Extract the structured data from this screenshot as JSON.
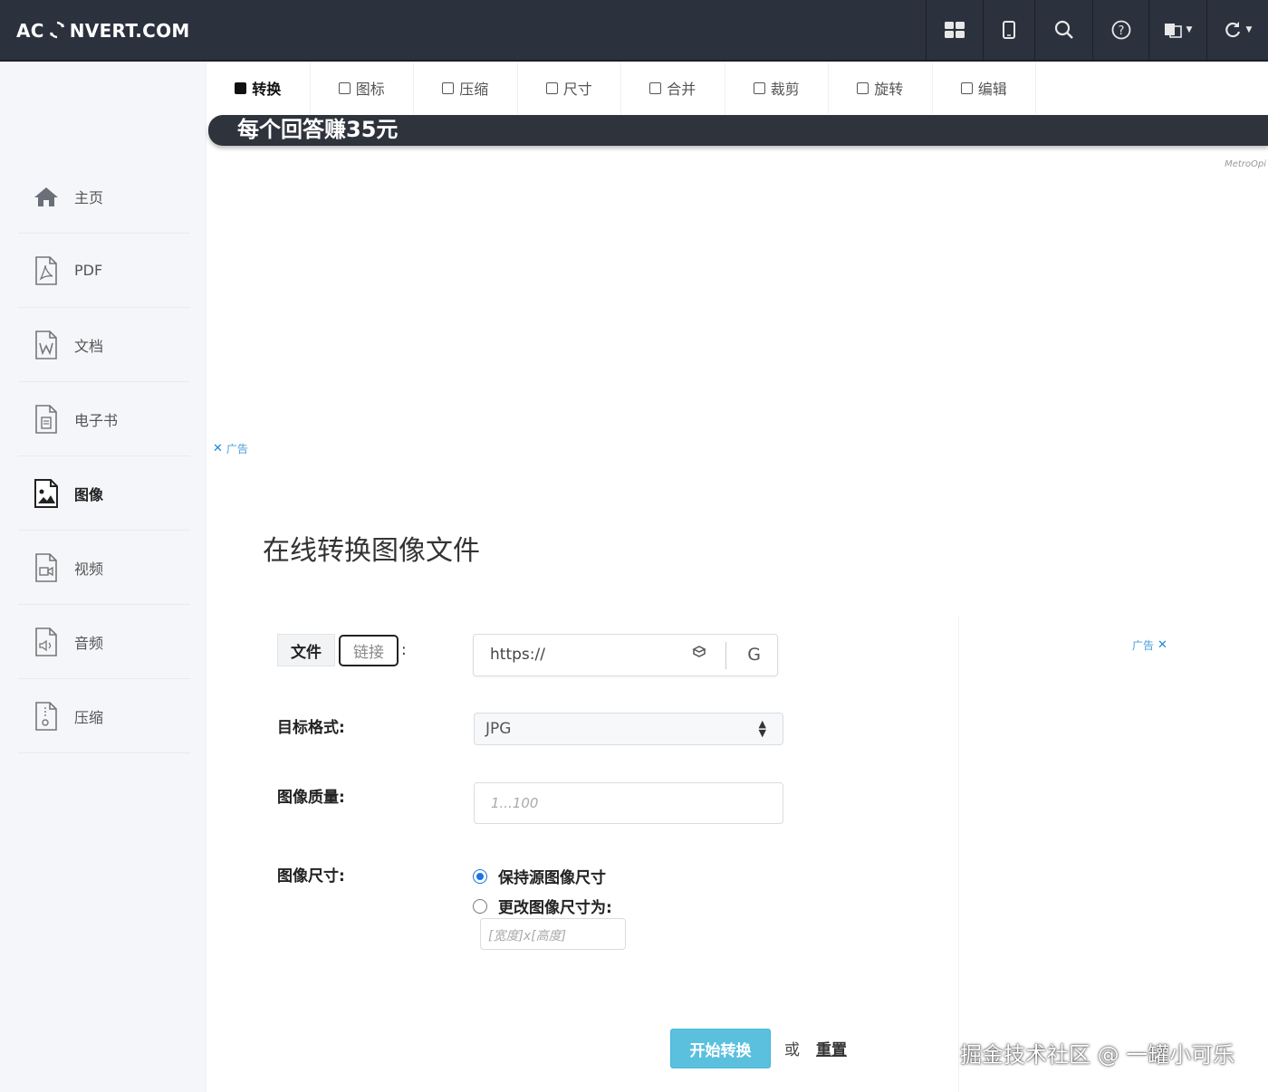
{
  "brand": {
    "logo_left": "AC",
    "logo_right": "NVERT.COM"
  },
  "topnav": {
    "icons": [
      "grid-icon",
      "mobile-icon",
      "search-icon",
      "help-icon",
      "language-icon",
      "refresh-icon"
    ]
  },
  "sidebar": {
    "items": [
      {
        "label": "主页",
        "icon": "home-icon"
      },
      {
        "label": "PDF",
        "icon": "pdf-file-icon"
      },
      {
        "label": "文档",
        "icon": "word-file-icon"
      },
      {
        "label": "电子书",
        "icon": "ebook-file-icon"
      },
      {
        "label": "图像",
        "icon": "image-file-icon",
        "active": true
      },
      {
        "label": "视频",
        "icon": "video-file-icon"
      },
      {
        "label": "音频",
        "icon": "audio-file-icon"
      },
      {
        "label": "压缩",
        "icon": "archive-file-icon"
      }
    ]
  },
  "subtabs": [
    {
      "label": "转换",
      "active": true
    },
    {
      "label": "图标"
    },
    {
      "label": "压缩"
    },
    {
      "label": "尺寸"
    },
    {
      "label": "合并"
    },
    {
      "label": "裁剪"
    },
    {
      "label": "旋转"
    },
    {
      "label": "编辑"
    }
  ],
  "banner": {
    "text": "每个回答赚35元",
    "small": "MetroOpi"
  },
  "ads": {
    "label": "广告",
    "close": "✕"
  },
  "main": {
    "title": "在线转换图像文件",
    "source": {
      "file_label": "文件",
      "link_label": "链接",
      "colon": ":"
    },
    "url": {
      "value": "https://",
      "button": "G"
    },
    "format": {
      "label": "目标格式:",
      "value": "JPG"
    },
    "quality": {
      "label": "图像质量:",
      "placeholder": "1...100"
    },
    "size": {
      "label": "图像尺寸:",
      "option_keep": "保持源图像尺寸",
      "option_change": "更改图像尺寸为:",
      "placeholder": "[宽度]x[高度]"
    },
    "start_button": "开始转换",
    "or_text": "或",
    "reset_link": "重置"
  },
  "watermark": "掘金技术社区 @ 一罐小可乐"
}
